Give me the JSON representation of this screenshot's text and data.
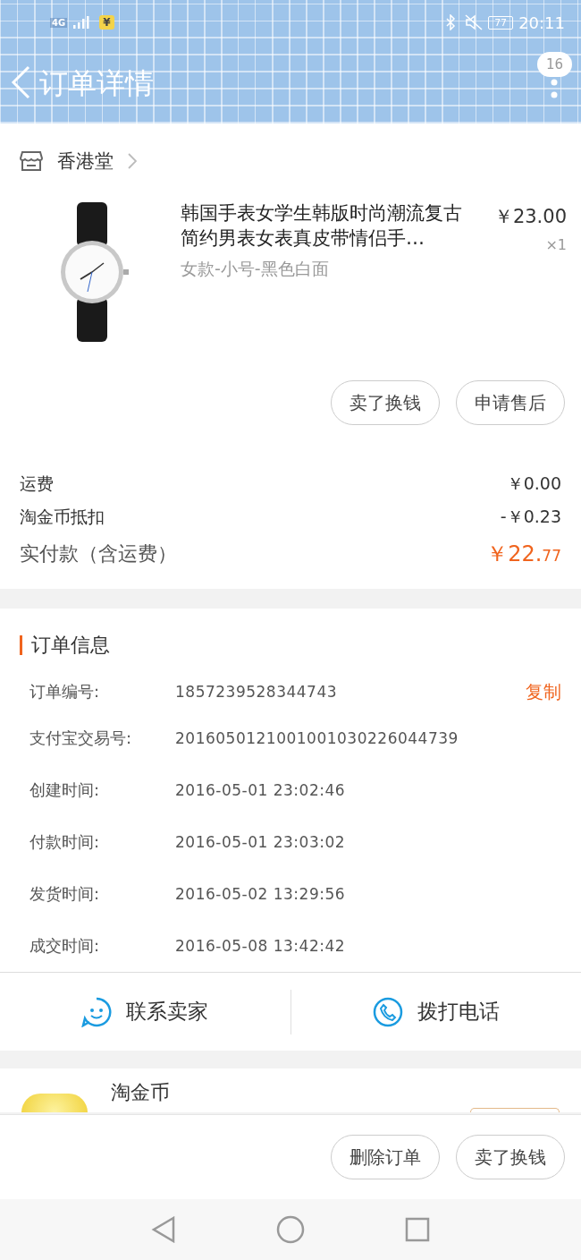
{
  "status_bar": {
    "network": "4G",
    "wallet_badge": "¥",
    "battery": "77",
    "time": "20:11"
  },
  "header": {
    "title": "订单详情",
    "badge": "16"
  },
  "shop": {
    "name": "香港堂"
  },
  "product": {
    "title": "韩国手表女学生韩版时尚潮流复古简约男表女表真皮带情侣手…",
    "price": "￥23.00",
    "quantity": "×1",
    "variant": "女款-小号-黑色白面"
  },
  "item_buttons": [
    "卖了换钱",
    "申请售后"
  ],
  "fees": [
    {
      "label": "运费",
      "value": "￥0.00",
      "kind": "plain"
    },
    {
      "label": "淘金币抵扣",
      "value": "-￥0.23",
      "kind": "plain"
    },
    {
      "label": "实付款（含运费）",
      "value": "￥22.",
      "value_small": "77",
      "kind": "total"
    }
  ],
  "order_info": {
    "title": "订单信息",
    "copy_link": "复制",
    "rows": [
      {
        "label": "订单编号:",
        "value": "1857239528344743"
      },
      {
        "label": "支付宝交易号:",
        "value": "2016050121001001030226044739"
      },
      {
        "label": "创建时间:",
        "value": "2016-05-01 23:02:46"
      },
      {
        "label": "付款时间:",
        "value": "2016-05-01 23:03:02"
      },
      {
        "label": "发货时间:",
        "value": "2016-05-02 13:29:56"
      },
      {
        "label": "成交时间:",
        "value": "2016-05-08 13:42:42"
      }
    ]
  },
  "contact_actions": [
    {
      "label": "联系卖家",
      "kind": "chat"
    },
    {
      "label": "拨打电话",
      "kind": "phone"
    }
  ],
  "coin_section": {
    "title": "淘金币"
  },
  "bottom_buttons": [
    "删除订单",
    "卖了换钱"
  ]
}
